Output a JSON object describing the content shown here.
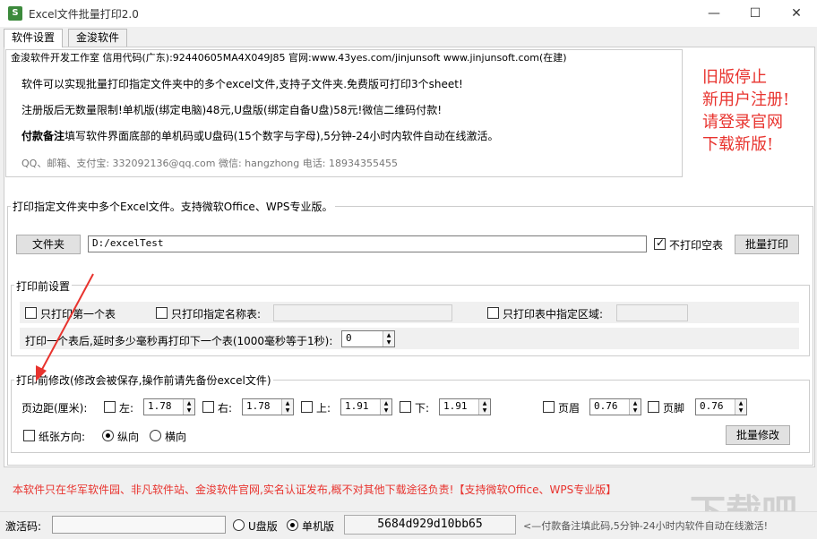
{
  "window": {
    "title": "Excel文件批量打印2.0",
    "icon_text": "S",
    "minimize": "—",
    "maximize": "☐",
    "close": "✕"
  },
  "tabs": [
    {
      "label": "软件设置"
    },
    {
      "label": "金浚软件"
    }
  ],
  "info": {
    "header": "金浚软件开发工作室 信用代码(广东):92440605MA4X049J85 官网:www.43yes.com/jinjunsoft  www.jinjunsoft.com(在建)",
    "line1": "软件可以实现批量打印指定文件夹中的多个excel文件,支持子文件夹.免费版可打印3个sheet!",
    "line2": "注册版后无数量限制!单机版(绑定电脑)48元,U盘版(绑定自备U盘)58元!微信二维码付款!",
    "line3_bold": "付款备注",
    "line3_rest": "填写软件界面底部的单机码或U盘码(15个数字与字母),5分钟-24小时内软件自动在线激活。",
    "contact": "QQ、邮箱、支付宝: 332092136@qq.com    微信: hangzhong    电话: 18934355455"
  },
  "notice": [
    "旧版停止",
    "新用户注册!",
    "请登录官网",
    "下载新版!"
  ],
  "print_group": {
    "title": "打印指定文件夹中多个Excel文件。支持微软Office、WPS专业版。",
    "folder_button": "文件夹",
    "path": "D:/excelTest",
    "skip_blank_label": "不打印空表",
    "batch_print_button": "批量打印"
  },
  "pre_settings": {
    "title": "打印前设置",
    "first_sheet_label": "只打印第一个表",
    "named_sheet_label": "只打印指定名称表:",
    "region_label": "只打印表中指定区域:",
    "delay_label": "打印一个表后,延时多少毫秒再打印下一个表(1000毫秒等于1秒):",
    "delay_value": "0"
  },
  "modify": {
    "title": "打印前修改(修改会被保存,操作前请先备份excel文件)",
    "margin_label": "页边距(厘米):",
    "left_label": "左:",
    "left_value": "1.78",
    "right_label": "右:",
    "right_value": "1.78",
    "top_label": "上:",
    "top_value": "1.91",
    "bottom_label": "下:",
    "bottom_value": "1.91",
    "header_label": "页眉",
    "header_value": "0.76",
    "footer_label": "页脚",
    "footer_value": "0.76",
    "orientation_label": "纸张方向:",
    "portrait_label": "纵向",
    "landscape_label": "横向",
    "batch_modify_button": "批量修改"
  },
  "footer_notice": "本软件只在华军软件园、非凡软件站、金浚软件官网,实名认证发布,概不对其他下载途径负责!【支持微软Office、WPS专业版】",
  "status": {
    "activation_label": "激活码:",
    "usb_label": "U盘版",
    "pc_label": "单机版",
    "machine_code": "5684d929d10bb65",
    "hint": "<—付款备注填此码,5分钟-24小时内软件自动在线激活!"
  },
  "watermark": "下载吧"
}
